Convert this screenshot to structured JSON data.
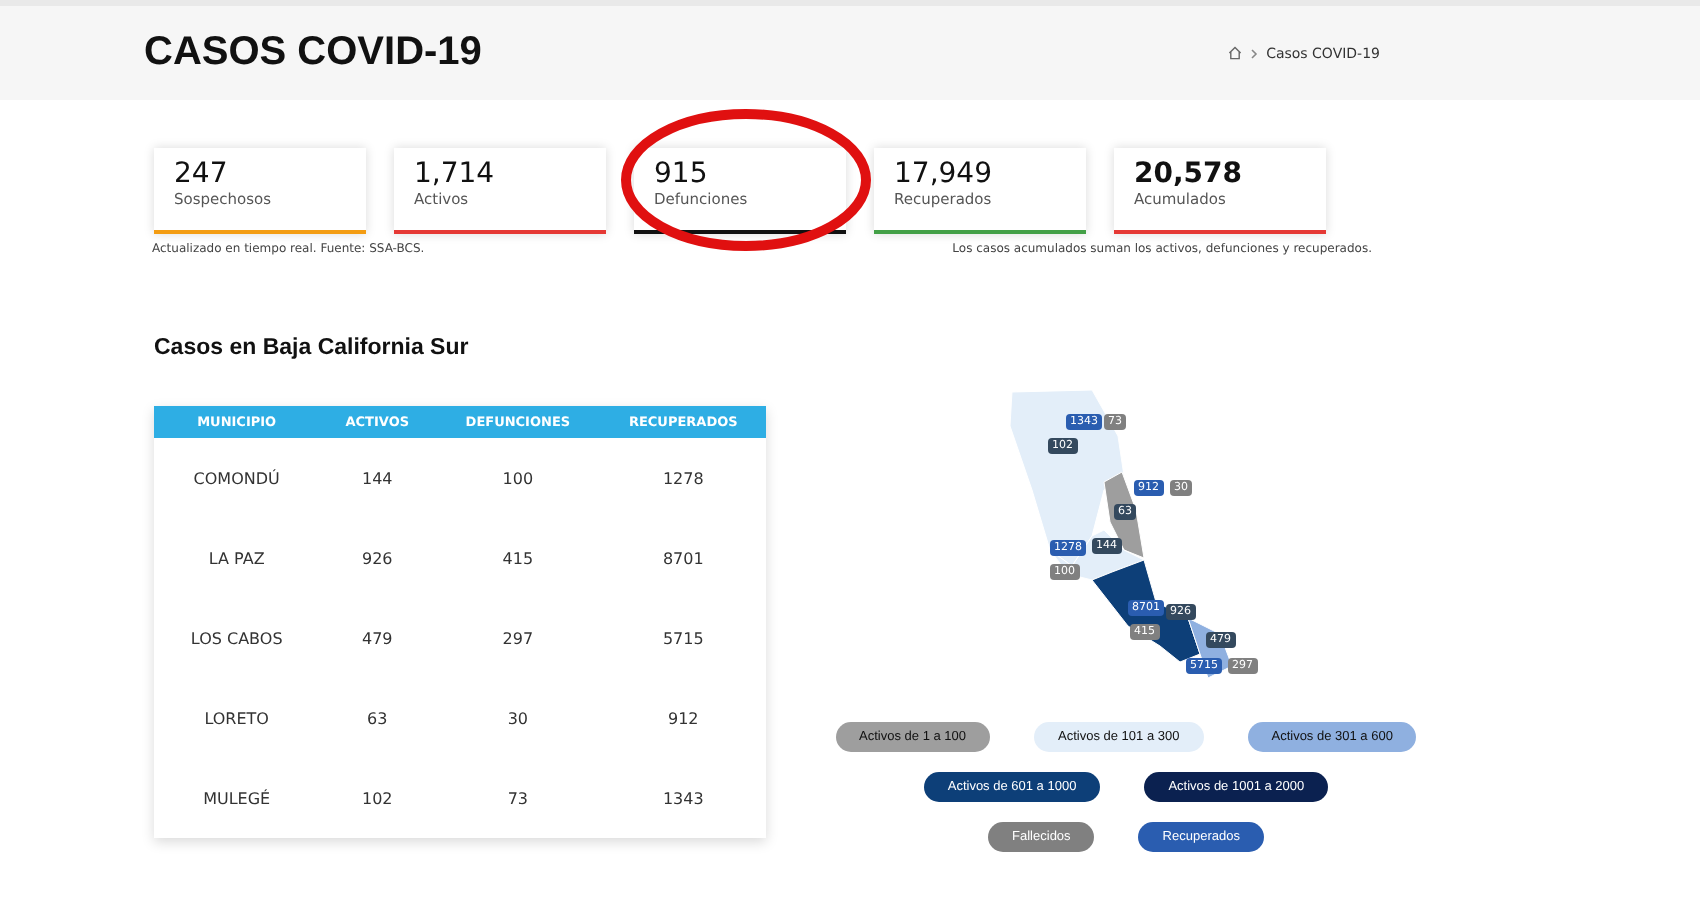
{
  "header": {
    "title": "CASOS COVID-19",
    "breadcrumb": "Casos COVID-19"
  },
  "stats": [
    {
      "value": "247",
      "label": "Sospechosos",
      "color": "#f39c12"
    },
    {
      "value": "1,714",
      "label": "Activos",
      "color": "#e53935"
    },
    {
      "value": "915",
      "label": "Defunciones",
      "color": "#111111"
    },
    {
      "value": "17,949",
      "label": "Recuperados",
      "color": "#43a047"
    },
    {
      "value": "20,578",
      "label": "Acumulados",
      "color": "#e53935"
    }
  ],
  "notes": {
    "left": "Actualizado en tiempo real. Fuente: SSA-BCS.",
    "right": "Los casos acumulados suman los activos, defunciones y recuperados."
  },
  "section_title": "Casos en Baja California Sur",
  "table": {
    "columns": [
      "MUNICIPIO",
      "ACTIVOS",
      "DEFUNCIONES",
      "RECUPERADOS"
    ],
    "rows": [
      [
        "COMONDÚ",
        "144",
        "100",
        "1278"
      ],
      [
        "LA PAZ",
        "926",
        "415",
        "8701"
      ],
      [
        "LOS CABOS",
        "479",
        "297",
        "5715"
      ],
      [
        "LORETO",
        "63",
        "30",
        "912"
      ],
      [
        "MULEGÉ",
        "102",
        "73",
        "1343"
      ]
    ]
  },
  "map": {
    "regions": [
      {
        "color": "#e3eef9"
      },
      {
        "color": "#9e9e9e"
      },
      {
        "color": "#e3eef9"
      },
      {
        "color": "#0d3f78"
      },
      {
        "color": "#8fb0e0"
      }
    ],
    "markers": [
      {
        "text": "1343",
        "kind": "recuperados"
      },
      {
        "text": "73",
        "kind": "fallecidos"
      },
      {
        "text": "102",
        "kind": "activos"
      },
      {
        "text": "912",
        "kind": "recuperados"
      },
      {
        "text": "30",
        "kind": "fallecidos"
      },
      {
        "text": "63",
        "kind": "activos"
      },
      {
        "text": "1278",
        "kind": "recuperados"
      },
      {
        "text": "100",
        "kind": "fallecidos"
      },
      {
        "text": "144",
        "kind": "activos"
      },
      {
        "text": "8701",
        "kind": "recuperados"
      },
      {
        "text": "415",
        "kind": "fallecidos"
      },
      {
        "text": "926",
        "kind": "activos"
      },
      {
        "text": "479",
        "kind": "activos"
      },
      {
        "text": "5715",
        "kind": "recuperados"
      },
      {
        "text": "297",
        "kind": "fallecidos"
      }
    ]
  },
  "legend": [
    [
      {
        "label": "Activos de 1 a 100",
        "color": "#9e9e9e"
      },
      {
        "label": "Activos de 101 a 300",
        "color": "#e3eef9"
      },
      {
        "label": "Activos de 301 a 600",
        "color": "#8fb0e0"
      }
    ],
    [
      {
        "label": "Activos de 601 a 1000",
        "color": "#0d3f78"
      },
      {
        "label": "Activos de 1001 a 2000",
        "color": "#0b2150"
      }
    ],
    [
      {
        "label": "Fallecidos",
        "color": "#808080"
      },
      {
        "label": "Recuperados",
        "color": "#2a5db0"
      }
    ]
  ]
}
